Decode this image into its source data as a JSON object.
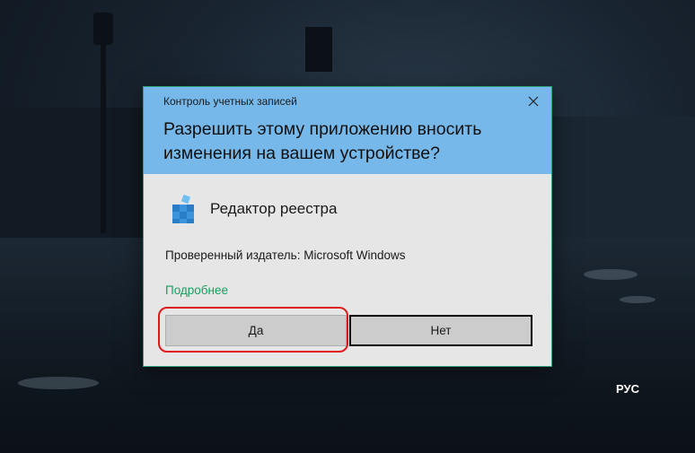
{
  "uac": {
    "window_title": "Контроль учетных записей",
    "question": "Разрешить этому приложению вносить изменения на вашем устройстве?",
    "app_name": "Редактор реестра",
    "publisher": "Проверенный издатель: Microsoft Windows",
    "details_link": "Подробнее",
    "yes_label": "Да",
    "no_label": "Нет"
  },
  "taskbar": {
    "language": "РУС"
  },
  "icons": {
    "close": "close-icon",
    "app": "registry-editor-icon"
  },
  "colors": {
    "header_bg": "#76b8ea",
    "dialog_bg": "#e6e6e6",
    "link": "#14a05f",
    "highlight": "#e0191e"
  }
}
